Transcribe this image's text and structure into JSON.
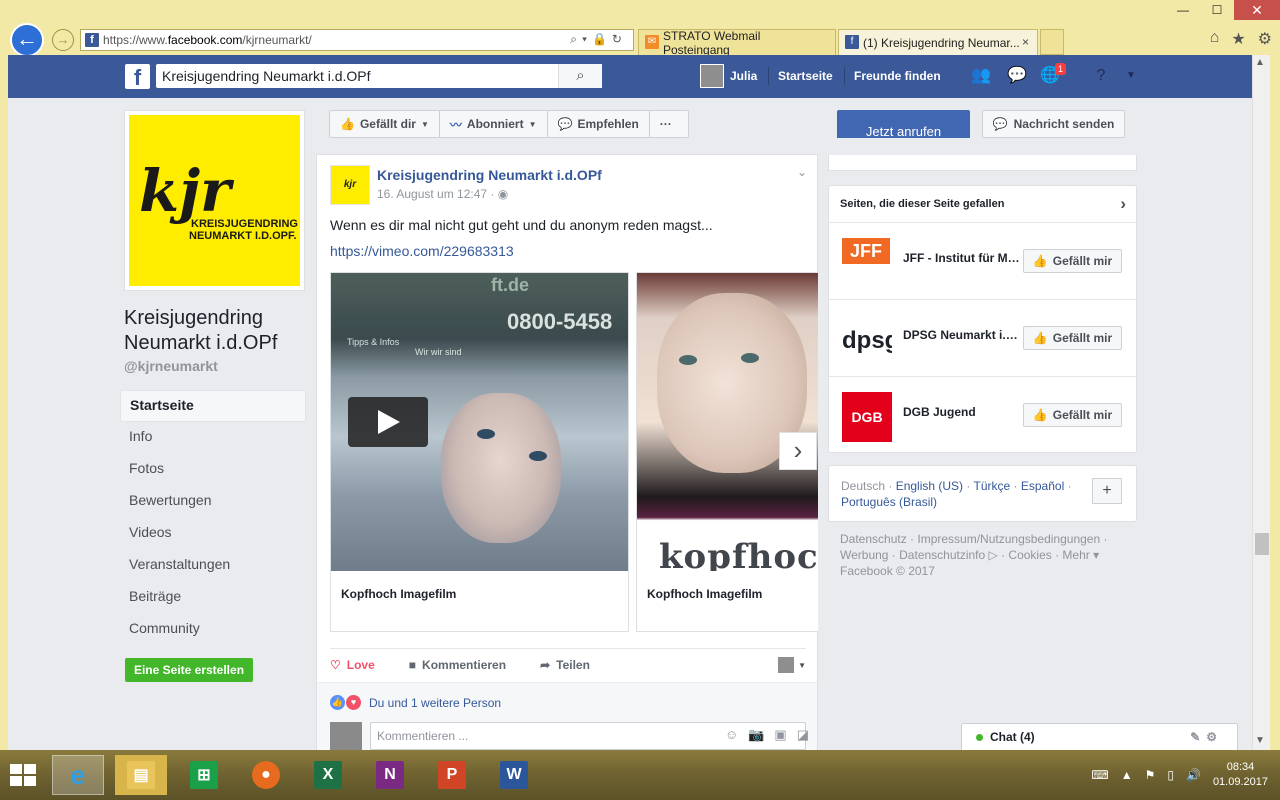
{
  "browser": {
    "url_prefix": "https://www.",
    "url_domain": "facebook.com",
    "url_path": "/kjrneumarkt/",
    "tabs": [
      {
        "label": "STRATO Webmail Posteingang"
      },
      {
        "label": "(1) Kreisjugendring Neumar..."
      }
    ],
    "tab_close": "×"
  },
  "header": {
    "logo": "f",
    "search_value": "Kreisjugendring Neumarkt i.d.OPf",
    "user_name": "Julia",
    "home_link": "Startseite",
    "friends_link": "Freunde finden",
    "notif_count": "1"
  },
  "page": {
    "logo_text": "kjr",
    "logo_sub1": "KREISJUGENDRING",
    "logo_sub2": "NEUMARKT I.D.OPF.",
    "name": "Kreisjugendring Neumarkt i.d.OPf",
    "handle": "@kjrneumarkt",
    "nav": [
      {
        "label": "Startseite"
      },
      {
        "label": "Info"
      },
      {
        "label": "Fotos"
      },
      {
        "label": "Bewertungen"
      },
      {
        "label": "Videos"
      },
      {
        "label": "Veranstaltungen"
      },
      {
        "label": "Beiträge"
      },
      {
        "label": "Community"
      }
    ],
    "create_page": "Eine Seite erstellen"
  },
  "actions": {
    "like": "Gefällt dir",
    "follow": "Abonniert",
    "recommend": "Empfehlen",
    "more": "···",
    "call": "Jetzt anrufen",
    "message": "Nachricht senden"
  },
  "post": {
    "author": "Kreisjugendring Neumarkt i.d.OPf",
    "time": "16. August um 12:47 · ",
    "text": "Wenn es dir mal nicht gut geht und du anonym reden magst...",
    "link": "https://vimeo.com/229683313",
    "cards": [
      {
        "caption": "Kopfhoch Imagefilm",
        "sign_number": "0800-5458",
        "sign_slogan": "Tipps & Infos",
        "sign_slogan2": "Wir wir sind",
        "sign_domain": "ft.de"
      },
      {
        "caption": "Kopfhoch Imagefilm",
        "overlay_text": "kopfhoch"
      }
    ],
    "love": "Love",
    "comment": "Kommentieren",
    "share": "Teilen",
    "reactions_text": "Du und 1 weitere Person",
    "comment_placeholder": "Kommentieren ..."
  },
  "sidebar": {
    "liked_title": "Seiten, die dieser Seite gefallen",
    "liked_pages": [
      {
        "name": "JFF - Institut für Medienpädagogik",
        "button": "Gefällt mir",
        "logo_text": "JFF"
      },
      {
        "name": "DPSG Neumarkt i.d.OPf",
        "button": "Gefällt mir",
        "logo_text": "dpsg"
      },
      {
        "name": "DGB Jugend",
        "button": "Gefällt mir",
        "logo_text": "DGB"
      }
    ],
    "languages": {
      "current": "Deutsch",
      "others": [
        "English (US)",
        "Türkçe",
        "Español",
        "Português (Brasil)"
      ],
      "plus": "+"
    },
    "footer_line1": "Datenschutz · Impressum/Nutzungsbedingungen ·",
    "footer_line2": "Werbung · Datenschutzinfo ▷ · Cookies · Mehr ▾",
    "footer_line3": "Facebook © 2017"
  },
  "chat": {
    "label": "Chat (4)"
  },
  "taskbar": {
    "time": "08:34",
    "date": "01.09.2017"
  }
}
